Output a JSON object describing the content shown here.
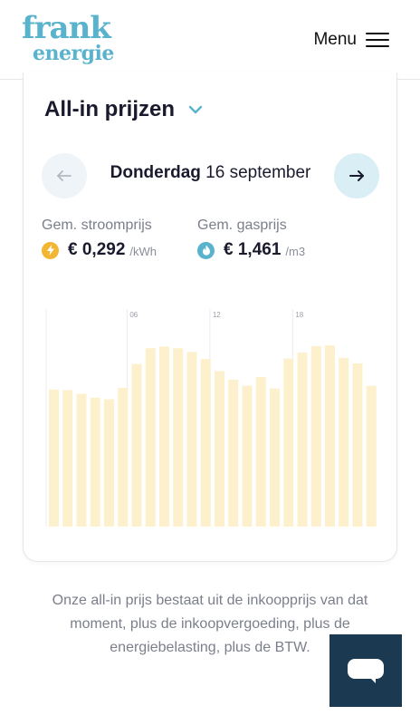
{
  "header": {
    "logo_line1": "frank",
    "logo_line2": "energie",
    "menu_label": "Menu"
  },
  "card": {
    "title": "All-in prijzen",
    "date_day": "Donderdag",
    "date_rest": " 16 september",
    "electricity": {
      "label": "Gem. stroomprijs",
      "value": "€ 0,292",
      "unit": "/kWh",
      "icon": "lightning-icon",
      "icon_color": "#f2b632"
    },
    "gas": {
      "label": "Gem. gasprijs",
      "value": "€ 1,461",
      "unit": "/m3",
      "icon": "flame-icon",
      "icon_color": "#5ab3cc"
    }
  },
  "chart_data": {
    "type": "bar",
    "categories": [
      "00",
      "01",
      "02",
      "03",
      "04",
      "05",
      "06",
      "07",
      "08",
      "09",
      "10",
      "11",
      "12",
      "13",
      "14",
      "15",
      "16",
      "17",
      "18",
      "19",
      "20",
      "21",
      "22",
      "23"
    ],
    "x_tick_labels": [
      "06",
      "12",
      "18"
    ],
    "values": [
      0.252,
      0.251,
      0.244,
      0.237,
      0.234,
      0.255,
      0.299,
      0.328,
      0.331,
      0.328,
      0.321,
      0.308,
      0.286,
      0.27,
      0.259,
      0.275,
      0.254,
      0.309,
      0.32,
      0.332,
      0.333,
      0.31,
      0.3,
      0.259
    ],
    "ylim": [
      0,
      0.4
    ],
    "bar_color": "#fdf0cc",
    "grid": false
  },
  "footnote": "Onze all-in prijs bestaat uit de inkoopprijs van dat moment, plus de inkoopvergoeding, plus de energiebelasting, plus de BTW.",
  "colors": {
    "brand": "#5ab3cc",
    "chat_button": "#1b3a52"
  }
}
